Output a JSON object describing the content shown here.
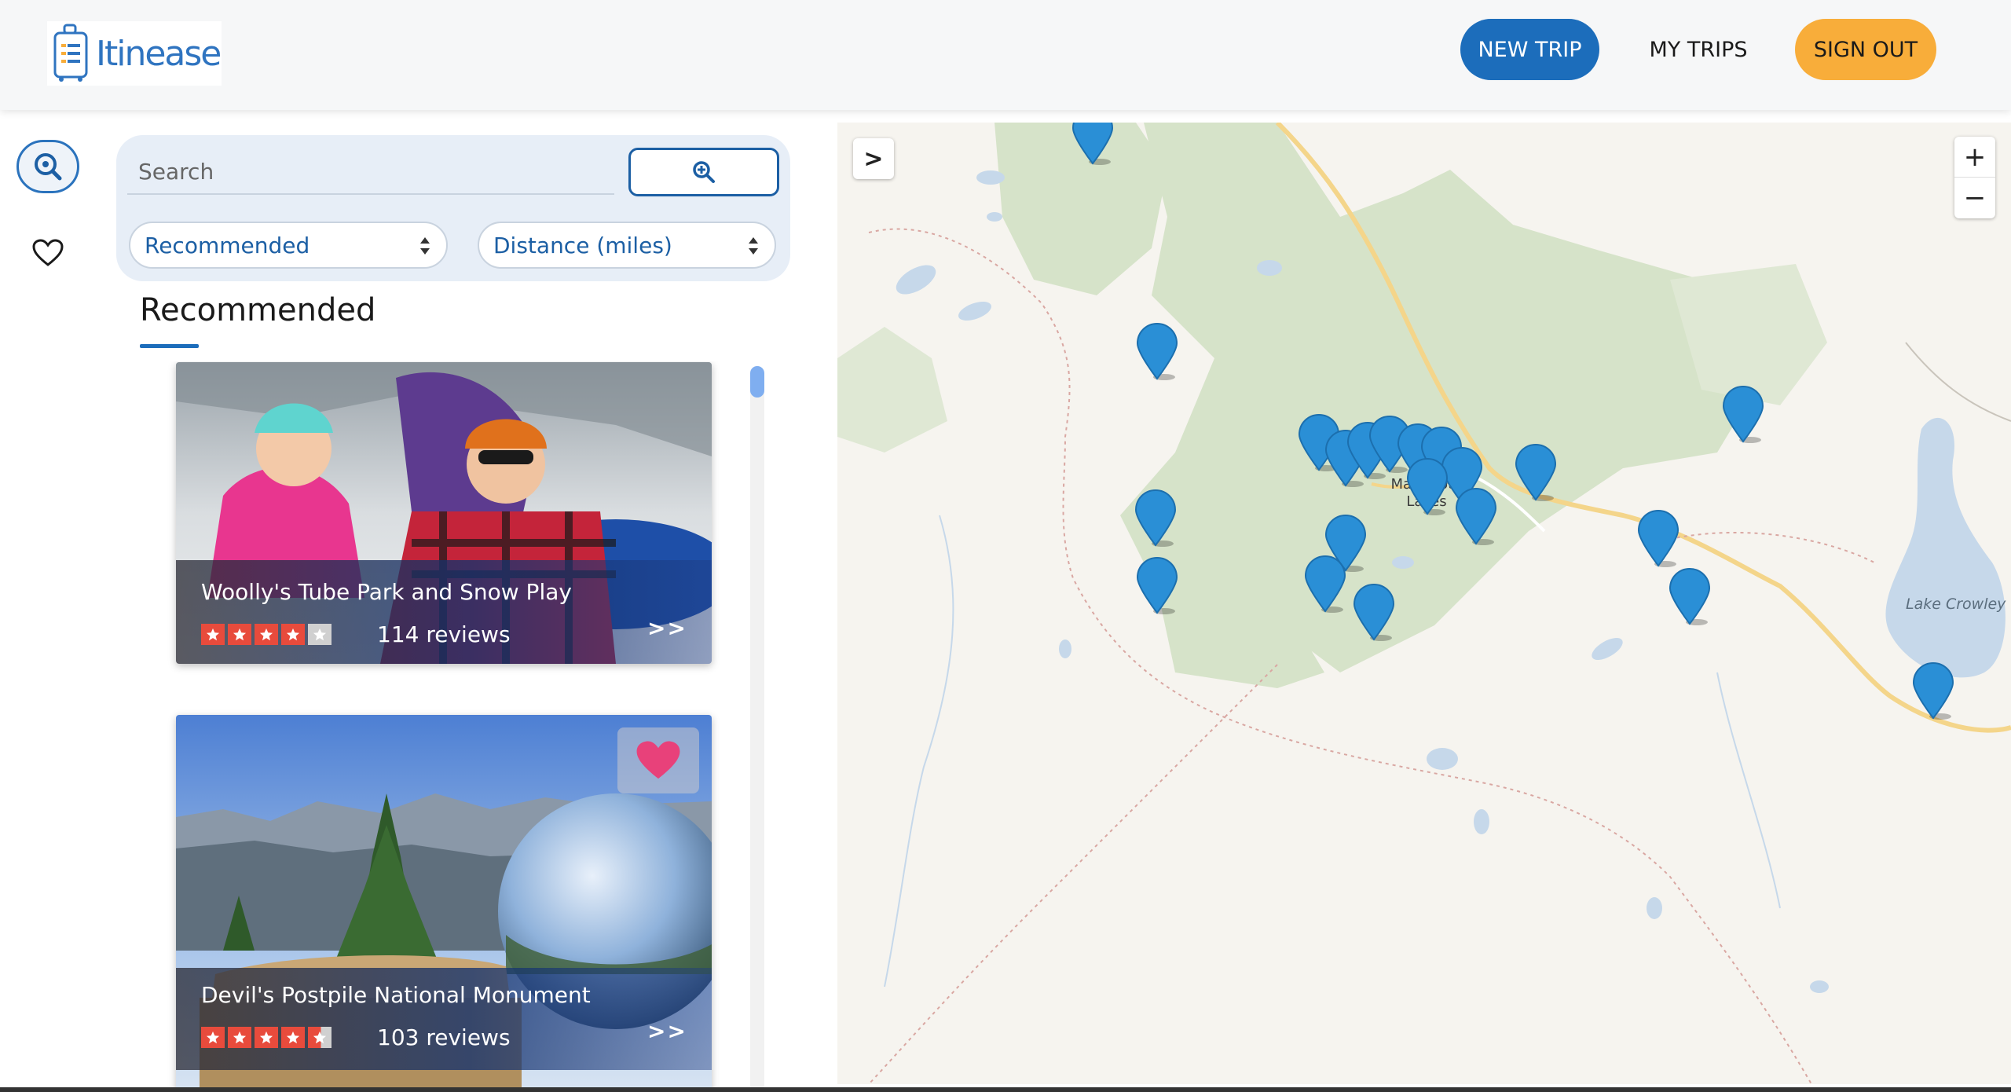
{
  "header": {
    "logo_text": "Itinease",
    "new_trip": "NEW TRIP",
    "my_trips": "MY TRIPS",
    "sign_out": "SIGN OUT"
  },
  "search": {
    "placeholder": "Search",
    "sort_selected": "Recommended",
    "distance_selected": "Distance (miles)"
  },
  "section_title": "Recommended",
  "cards": [
    {
      "name": "Woolly's Tube Park and Snow Play",
      "rating": 4,
      "reviews": "114 reviews",
      "chevron": ">>",
      "favorited": false
    },
    {
      "name": "Devil's Postpile National Monument",
      "rating": 4.5,
      "reviews": "103 reviews",
      "chevron": ">>",
      "favorited": true
    }
  ],
  "map": {
    "toggle": ">",
    "zoom_in": "+",
    "zoom_out": "−",
    "lake_label": "Lake Crowley",
    "town_label": "Mammoth Lakes"
  },
  "colors": {
    "primary": "#1c6dbb",
    "accent": "#f8ad3a",
    "marker": "#2a8fd6",
    "heart": "#e8417a"
  }
}
